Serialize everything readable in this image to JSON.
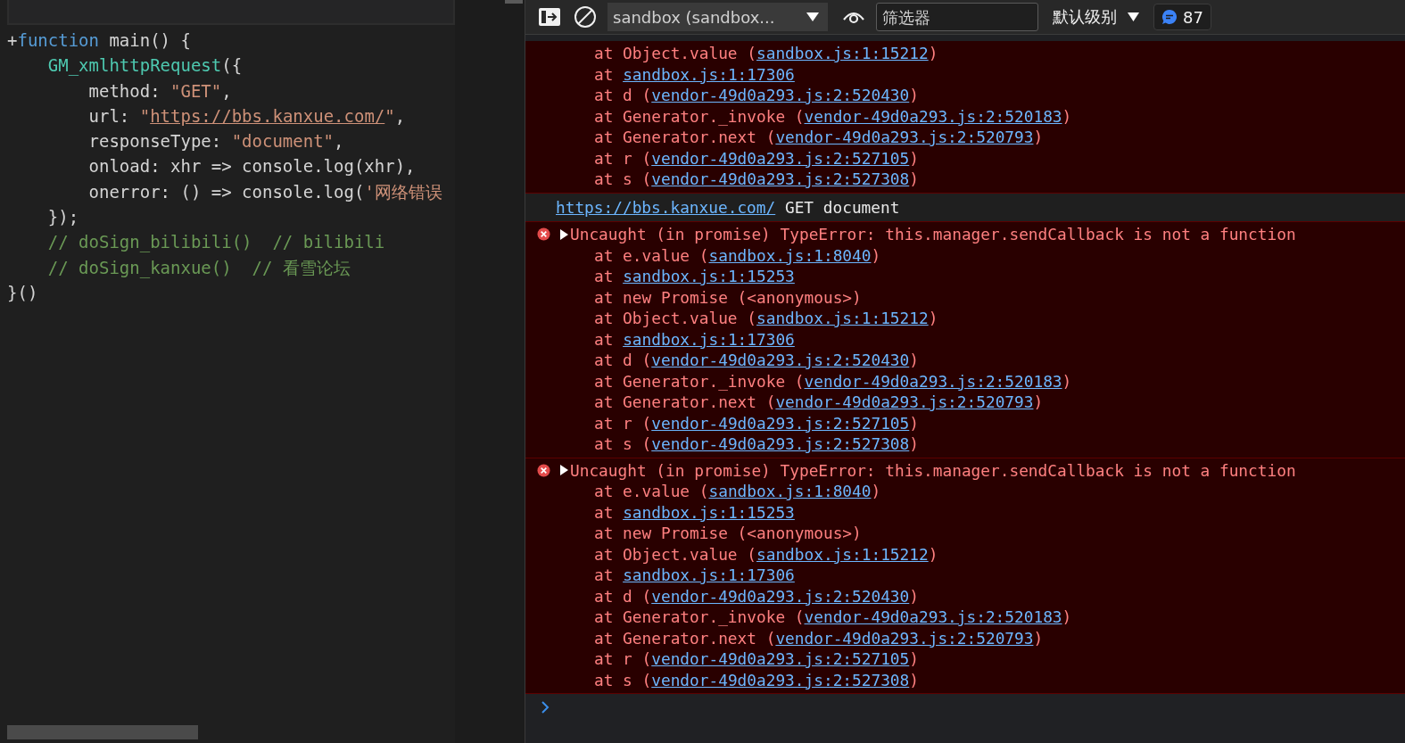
{
  "editor": {
    "lines": [
      [
        {
          "t": "+",
          "kind": "plain"
        },
        {
          "t": "function",
          "kind": "keyword"
        },
        {
          "t": " main() {",
          "kind": "plain"
        }
      ],
      [
        {
          "t": "    GM_xmlhttpRequest",
          "kind": "func"
        },
        {
          "t": "({",
          "kind": "plain"
        }
      ],
      [
        {
          "t": "        method: ",
          "kind": "plain"
        },
        {
          "t": "\"GET\"",
          "kind": "string"
        },
        {
          "t": ",",
          "kind": "plain"
        }
      ],
      [
        {
          "t": "        url: ",
          "kind": "plain"
        },
        {
          "t": "\"",
          "kind": "string"
        },
        {
          "t": "https://bbs.kanxue.com/",
          "kind": "link"
        },
        {
          "t": "\"",
          "kind": "string"
        },
        {
          "t": ",",
          "kind": "plain"
        }
      ],
      [
        {
          "t": "        responseType: ",
          "kind": "plain"
        },
        {
          "t": "\"document\"",
          "kind": "string"
        },
        {
          "t": ",",
          "kind": "plain"
        }
      ],
      [
        {
          "t": "        onload: xhr => console.log(xhr),",
          "kind": "plain"
        }
      ],
      [
        {
          "t": "        onerror: () => console.log(",
          "kind": "plain"
        },
        {
          "t": "'网络错误",
          "kind": "string"
        }
      ],
      [
        {
          "t": "    });",
          "kind": "plain"
        }
      ],
      [
        {
          "t": "    // doSign_bilibili()  // bilibili",
          "kind": "comment"
        }
      ],
      [
        {
          "t": "    // doSign_kanxue()  // 看雪论坛",
          "kind": "comment"
        }
      ],
      [
        {
          "t": "}()",
          "kind": "plain"
        }
      ]
    ]
  },
  "console": {
    "toolbar": {
      "context": "sandbox (sandbox...",
      "filter_placeholder": "筛选器",
      "level": "默认级别",
      "message_count": "87"
    },
    "messages": [
      {
        "kind": "error",
        "frames": [
          {
            "pre": "at Object.value (",
            "link": "sandbox.js:1:15212",
            "post": ")"
          },
          {
            "pre": "at ",
            "link": "sandbox.js:1:17306"
          },
          {
            "pre": "at d (",
            "link": "vendor-49d0a293.js:2:520430",
            "post": ")"
          },
          {
            "pre": "at Generator._invoke (",
            "link": "vendor-49d0a293.js:2:520183",
            "post": ")"
          },
          {
            "pre": "at Generator.next (",
            "link": "vendor-49d0a293.js:2:520793",
            "post": ")"
          },
          {
            "pre": "at r (",
            "link": "vendor-49d0a293.js:2:527105",
            "post": ")"
          },
          {
            "pre": "at s (",
            "link": "vendor-49d0a293.js:2:527308",
            "post": ")"
          }
        ]
      },
      {
        "kind": "log",
        "link": "https://bbs.kanxue.com/",
        "text": "GET document"
      },
      {
        "kind": "error",
        "header": "Uncaught (in promise) TypeError: this.manager.sendCallback is not a function",
        "expanded": false,
        "frames": [
          {
            "pre": "at e.value (",
            "link": "sandbox.js:1:8040",
            "post": ")"
          },
          {
            "pre": "at ",
            "link": "sandbox.js:1:15253"
          },
          {
            "pre": "at new Promise (<anonymous>)"
          },
          {
            "pre": "at Object.value (",
            "link": "sandbox.js:1:15212",
            "post": ")"
          },
          {
            "pre": "at ",
            "link": "sandbox.js:1:17306"
          },
          {
            "pre": "at d (",
            "link": "vendor-49d0a293.js:2:520430",
            "post": ")"
          },
          {
            "pre": "at Generator._invoke (",
            "link": "vendor-49d0a293.js:2:520183",
            "post": ")"
          },
          {
            "pre": "at Generator.next (",
            "link": "vendor-49d0a293.js:2:520793",
            "post": ")"
          },
          {
            "pre": "at r (",
            "link": "vendor-49d0a293.js:2:527105",
            "post": ")"
          },
          {
            "pre": "at s (",
            "link": "vendor-49d0a293.js:2:527308",
            "post": ")"
          }
        ]
      },
      {
        "kind": "error",
        "header": "Uncaught (in promise) TypeError: this.manager.sendCallback is not a function",
        "expanded": false,
        "frames": [
          {
            "pre": "at e.value (",
            "link": "sandbox.js:1:8040",
            "post": ")"
          },
          {
            "pre": "at ",
            "link": "sandbox.js:1:15253"
          },
          {
            "pre": "at new Promise (<anonymous>)"
          },
          {
            "pre": "at Object.value (",
            "link": "sandbox.js:1:15212",
            "post": ")"
          },
          {
            "pre": "at ",
            "link": "sandbox.js:1:17306"
          },
          {
            "pre": "at d (",
            "link": "vendor-49d0a293.js:2:520430",
            "post": ")"
          },
          {
            "pre": "at Generator._invoke (",
            "link": "vendor-49d0a293.js:2:520183",
            "post": ")"
          },
          {
            "pre": "at Generator.next (",
            "link": "vendor-49d0a293.js:2:520793",
            "post": ")"
          },
          {
            "pre": "at r (",
            "link": "vendor-49d0a293.js:2:527105",
            "post": ")"
          },
          {
            "pre": "at s (",
            "link": "vendor-49d0a293.js:2:527308",
            "post": ")"
          }
        ]
      }
    ]
  }
}
